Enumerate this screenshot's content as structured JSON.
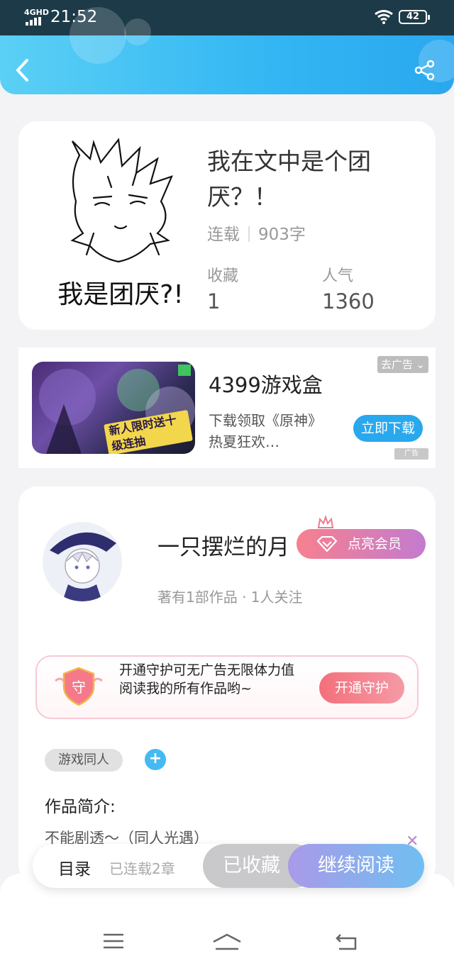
{
  "status_bar": {
    "network": "4GHD",
    "time": "21:52",
    "battery": "42"
  },
  "book": {
    "title": "我在文中是个团厌？！",
    "status": "连载",
    "word_count": "903字",
    "stats": [
      {
        "label": "收藏",
        "value": "1"
      },
      {
        "label": "人气",
        "value": "1360"
      }
    ],
    "cover_text": "我是团厌?!"
  },
  "ad": {
    "title": "4399游戏盒",
    "description": "下载领取《原神》热夏狂欢…",
    "close_label": "去广告",
    "download_label": "立即下载",
    "ad_mark": "广告",
    "image_text": "新人限时送十级连抽"
  },
  "author": {
    "name": "一只摆烂的月",
    "vip_label": "点亮会员",
    "stats": "著有1部作品 · 1人关注",
    "guard_text": "开通守护可无广告无限体力值阅读我的所有作品哟~",
    "guard_badge": "守",
    "guard_button": "开通守护",
    "tag": "游戏同人",
    "intro_label": "作品简介:",
    "intro_text": "不能剧透～（同人光遇）"
  },
  "bottom_bar": {
    "toc_label": "目录",
    "chapter_count": "已连载2章",
    "favorited_label": "已收藏",
    "continue_label": "继续阅读"
  },
  "colors": {
    "accent": "#33b6f3",
    "vip": "#f7808f",
    "guard": "#f3707a"
  }
}
